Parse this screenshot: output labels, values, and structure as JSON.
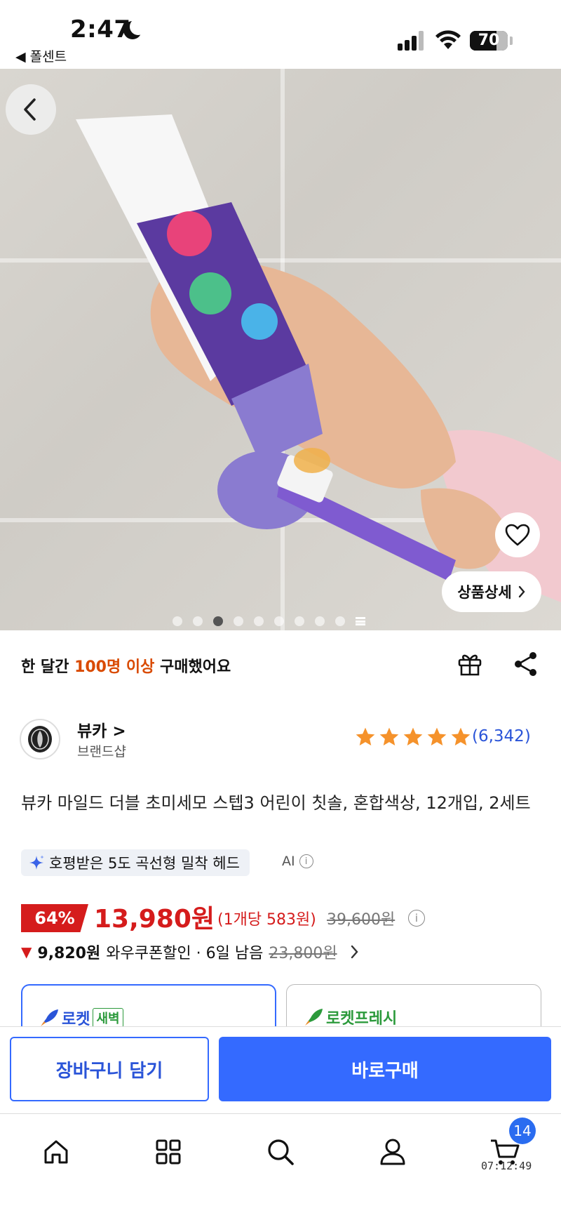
{
  "status_bar": {
    "time": "2:47",
    "back_app": "◀ 폴센트",
    "battery": "70"
  },
  "hero": {
    "detail_label": "상품상세",
    "dot_count": 10,
    "active_dot_index": 2
  },
  "purchase_info": {
    "prefix": "한 달간",
    "highlight": "100명 이상",
    "suffix": "구매했어요"
  },
  "brand": {
    "name": "뷰카 >",
    "sub": "브랜드샵",
    "rating_stars": 5,
    "rating_count": "(6,342)"
  },
  "product": {
    "title": "뷰카 마일드 더블 초미세모 스텝3 어린이 칫솔, 혼합색상, 12개입, 2세트",
    "ai_chip": "호평받은 5도 곡선형 밀착 헤드",
    "ai_label": "AI"
  },
  "price": {
    "discount": "64%",
    "price": "13,980원",
    "unit_price": "(1개당 583원)",
    "original": "39,600원",
    "coupon_price": "9,820원",
    "coupon_text": "와우쿠폰할인 · 6일 남음",
    "coupon_original": "23,800원"
  },
  "delivery": {
    "option_a": "로켓",
    "option_a_tag": "새벽",
    "option_b": "로켓프레시"
  },
  "actions": {
    "cart": "장바구니 담기",
    "buy": "바로구매"
  },
  "tab_bar": {
    "cart_badge": "14",
    "clock": "07:12:49"
  },
  "colors": {
    "accent_blue": "#346aff",
    "price_red": "#d51c1c",
    "highlight_orange": "#d94a00",
    "star_orange": "#f5922b"
  }
}
